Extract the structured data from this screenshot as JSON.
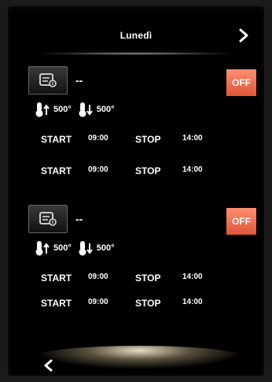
{
  "header": {
    "title": "Lunedì"
  },
  "programs": [
    {
      "name": "--",
      "off_label": "OFF",
      "temp_up": "500°",
      "temp_down": "500°",
      "rows": [
        {
          "start_label": "START",
          "start": "09:00",
          "stop_label": "STOP",
          "stop": "14:00"
        },
        {
          "start_label": "START",
          "start": "09:00",
          "stop_label": "STOP",
          "stop": "14:00"
        }
      ]
    },
    {
      "name": "--",
      "off_label": "OFF",
      "temp_up": "500°",
      "temp_down": "500°",
      "rows": [
        {
          "start_label": "START",
          "start": "09:00",
          "stop_label": "STOP",
          "stop": "14:00"
        },
        {
          "start_label": "START",
          "start": "09:00",
          "stop_label": "STOP",
          "stop": "14:00"
        }
      ]
    }
  ],
  "colors": {
    "off_button": "#e8623f",
    "background": "#000000",
    "text": "#ffffff"
  },
  "icons": {
    "next": "chevron-right-icon",
    "back": "chevron-left-icon",
    "program": "program-settings-icon",
    "temp_up": "thermometer-up-icon",
    "temp_down": "thermometer-down-icon"
  }
}
